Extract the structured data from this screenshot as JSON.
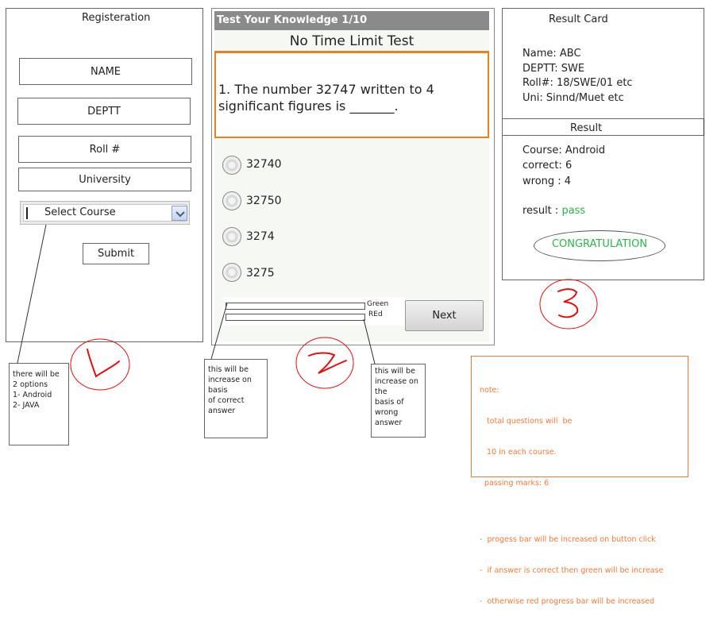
{
  "registration": {
    "title": "Registeration",
    "name_field": "NAME",
    "deptt_field": "DEPTT",
    "roll_field": "Roll #",
    "university_field": "University",
    "course_select": "Select Course",
    "submit_label": "Submit"
  },
  "quiz": {
    "header": "Test Your Knowledge 1/10",
    "subtitle": "No Time Limit Test",
    "question_line1": "1.  The number 32747 written to 4",
    "question_line2": "significant figures is _______.",
    "options": [
      "32740",
      "32750",
      "3274",
      "3275"
    ],
    "green_label": "Green",
    "red_label": "REd",
    "next_label": "Next"
  },
  "result_card": {
    "title": "Result Card",
    "name": "Name: ABC",
    "deptt": "DEPTT: SWE",
    "roll": "Roll#: 18/SWE/01 etc",
    "uni": "Uni: Sinnd/Muet etc",
    "result_header": "Result",
    "course": "Course: Android",
    "correct": "correct: 6",
    "wrong": "wrong : 4",
    "result_prefix": "result : ",
    "result_value": "pass",
    "congrats": "CONGRATULATION"
  },
  "annotations": {
    "course_note": [
      "there will be",
      "2 options",
      "1- Android",
      "2- JAVA"
    ],
    "green_note": [
      "this will be",
      "increase on basis",
      "of correct answer"
    ],
    "red_note": [
      "this will be",
      "increase on the",
      "basis of wrong",
      "answer"
    ],
    "general_note": [
      "note:",
      "   total questions will  be",
      "   10 in each course.",
      "  passing marks: 6",
      "",
      "-  progess bar will be increased on button click",
      "-  if answer is correct then green will be increase",
      "-  otherwise red progress bar will be increased"
    ]
  },
  "colors": {
    "quiz_header_bg": "#8a8a8a",
    "question_border": "#e8821e",
    "pass_green": "#2db34a",
    "annotation_red": "#e01010",
    "note_orange": "#f07a3a"
  }
}
